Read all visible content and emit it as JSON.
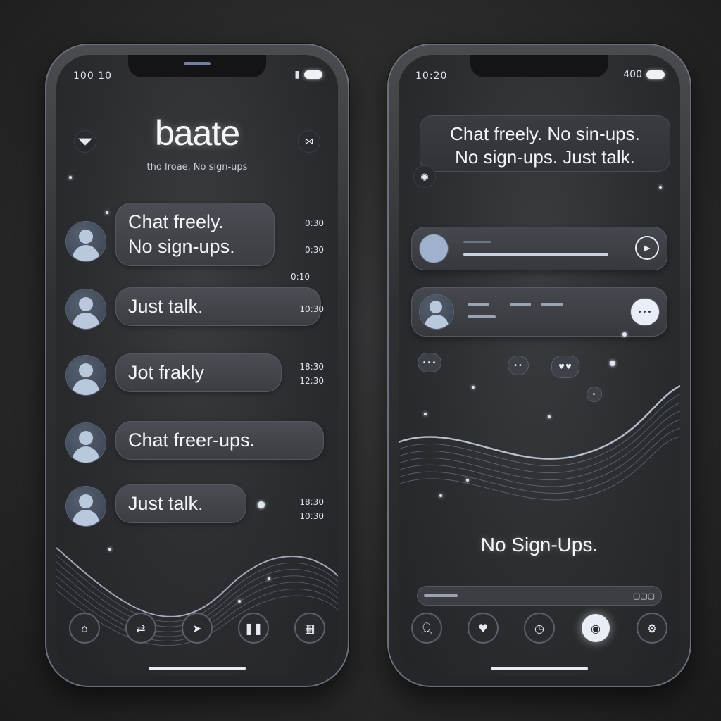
{
  "left_phone": {
    "status_time": "100 10",
    "app_title": "baate",
    "app_subtitle": "tho lroae, No sign-ups",
    "messages": [
      {
        "text": "Chat freely.\nNo sign-ups.",
        "timestamps": [
          "0:30",
          "0:30"
        ]
      },
      {
        "text": "Just talk.",
        "timestamps": [
          "10:30"
        ]
      },
      {
        "text": "Jot frakly",
        "timestamps": [
          "18:30",
          "12:30"
        ]
      },
      {
        "text": "Chat freer-ups.",
        "timestamps": []
      },
      {
        "text": "Just talk.",
        "timestamps": [
          "18:30",
          "10:30"
        ]
      }
    ],
    "extra_time": "0:10",
    "nav_icons": [
      "home-icon",
      "share-icon",
      "send-icon",
      "pause-icon",
      "gallery-icon"
    ]
  },
  "right_phone": {
    "status_time": "10:20",
    "status_right": "400",
    "banner_text": "Chat freely. No sin-ups.\nNo sign-ups. Just talk.",
    "slogan": "No Sign-Ups.",
    "nav_icons": [
      "profile-icon",
      "heart-icon",
      "clock-icon",
      "chat-icon",
      "settings-icon"
    ],
    "active_nav": 3
  }
}
